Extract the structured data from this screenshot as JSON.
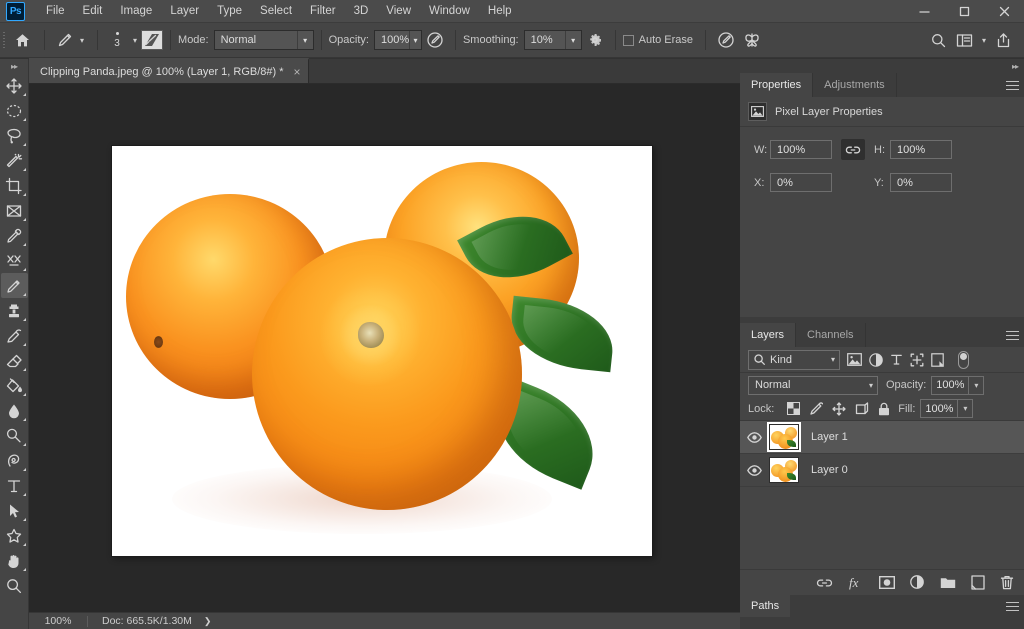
{
  "app": {
    "logo_text": "Ps",
    "menus": [
      "File",
      "Edit",
      "Image",
      "Layer",
      "Type",
      "Select",
      "Filter",
      "3D",
      "View",
      "Window",
      "Help"
    ],
    "window_controls": {
      "minimize": "–",
      "maximize": "☐",
      "close": "✕"
    }
  },
  "options_bar": {
    "home_icon": "home-icon",
    "brush_preset_icon": "pencil-icon",
    "brush_size": "3",
    "brush_panel_icon": "brush-panel-icon",
    "mode_label": "Mode:",
    "mode_value": "Normal",
    "opacity_label": "Opacity:",
    "opacity_value": "100%",
    "pressure_opacity_icon": "pressure-opacity-icon",
    "smoothing_label": "Smoothing:",
    "smoothing_value": "10%",
    "smoothing_options_icon": "gear-icon",
    "auto_erase_label": "Auto Erase",
    "auto_erase_checked": false,
    "pressure_size_icon": "pressure-size-icon",
    "symmetry_icon": "butterfly-symmetry-icon",
    "search_icon": "search-icon",
    "workspace_icon": "workspace-icon",
    "share_icon": "share-icon"
  },
  "toolbar": {
    "collapse_icon": "double-chevron-right-icon",
    "tools": [
      {
        "name": "move-tool",
        "icon": "move-icon",
        "active": false
      },
      {
        "name": "elliptical-marquee-tool",
        "icon": "ellipse-marquee-icon",
        "active": false
      },
      {
        "name": "lasso-tool",
        "icon": "lasso-icon",
        "active": false
      },
      {
        "name": "object-selection-tool",
        "icon": "magic-wand-icon",
        "active": false
      },
      {
        "name": "crop-tool",
        "icon": "crop-icon",
        "active": false
      },
      {
        "name": "frame-tool",
        "icon": "frame-icon",
        "active": false
      },
      {
        "name": "eyedropper-tool",
        "icon": "eyedropper-icon",
        "active": false
      },
      {
        "name": "spot-healing-brush-tool",
        "icon": "healing-brush-icon",
        "active": false
      },
      {
        "name": "pencil-tool",
        "icon": "pencil-icon",
        "active": true
      },
      {
        "name": "clone-stamp-tool",
        "icon": "clone-stamp-icon",
        "active": false
      },
      {
        "name": "history-brush-tool",
        "icon": "history-brush-icon",
        "active": false
      },
      {
        "name": "eraser-tool",
        "icon": "eraser-icon",
        "active": false
      },
      {
        "name": "gradient-tool",
        "icon": "paint-bucket-icon",
        "active": false
      },
      {
        "name": "blur-tool",
        "icon": "water-drop-icon",
        "active": false
      },
      {
        "name": "dodge-tool",
        "icon": "dodge-icon",
        "active": false
      },
      {
        "name": "pen-tool",
        "icon": "pen-icon",
        "active": false
      },
      {
        "name": "type-tool",
        "icon": "type-icon",
        "active": false
      },
      {
        "name": "path-selection-tool",
        "icon": "arrow-pointer-icon",
        "active": false
      },
      {
        "name": "custom-shape-tool",
        "icon": "shape-icon",
        "active": false
      },
      {
        "name": "hand-tool",
        "icon": "hand-icon",
        "active": false
      },
      {
        "name": "zoom-tool",
        "icon": "magnifier-icon",
        "active": false
      }
    ]
  },
  "document": {
    "tab_title": "Clipping Panda.jpeg @ 100% (Layer 1, RGB/8#) *",
    "close_icon": "close-icon"
  },
  "status_bar": {
    "zoom": "100%",
    "doc_info": "Doc: 665.5K/1.30M",
    "expand_icon": "chevron-right-icon"
  },
  "properties_panel": {
    "tabs": [
      {
        "label": "Properties",
        "active": true
      },
      {
        "label": "Adjustments",
        "active": false
      }
    ],
    "menu_icon": "panel-menu-icon",
    "header_icon": "pixel-layer-icon",
    "header_title": "Pixel Layer Properties",
    "fields": {
      "w_label": "W:",
      "w_value": "100%",
      "link_icon": "link-icon",
      "h_label": "H:",
      "h_value": "100%",
      "x_label": "X:",
      "x_value": "0%",
      "y_label": "Y:",
      "y_value": "0%"
    }
  },
  "layers_panel": {
    "tabs": [
      {
        "label": "Layers",
        "active": true
      },
      {
        "label": "Channels",
        "active": false
      }
    ],
    "menu_icon": "panel-menu-icon",
    "filter": {
      "search_icon": "search-icon",
      "kind_value": "Kind",
      "icons": [
        "pixel-filter-icon",
        "adjustment-filter-icon",
        "type-filter-icon",
        "shape-filter-icon",
        "smart-object-filter-icon"
      ],
      "toggle_icon": "filter-toggle-switch"
    },
    "blend": {
      "mode_value": "Normal",
      "opacity_label": "Opacity:",
      "opacity_value": "100%"
    },
    "lock": {
      "label": "Lock:",
      "icons": [
        "lock-transparent-pixels-icon",
        "lock-image-pixels-icon",
        "lock-position-icon",
        "lock-artboard-icon",
        "lock-all-icon"
      ],
      "fill_label": "Fill:",
      "fill_value": "100%"
    },
    "layers": [
      {
        "name": "Layer 1",
        "visible": true,
        "selected": true,
        "eye_icon": "eye-icon"
      },
      {
        "name": "Layer 0",
        "visible": true,
        "selected": false,
        "eye_icon": "eye-icon"
      }
    ],
    "footer_icons": [
      "link-layers-icon",
      "add-layer-style-icon",
      "add-layer-mask-icon",
      "new-fill-adjustment-icon",
      "new-group-icon",
      "new-layer-icon",
      "delete-layer-icon"
    ]
  },
  "paths_panel": {
    "tabs": [
      {
        "label": "Paths",
        "active": true
      }
    ],
    "menu_icon": "panel-menu-icon"
  },
  "canvas": {
    "image_alt": "three-oranges-with-leaves-on-white-background"
  },
  "colors": {
    "accent": "#31a8ff",
    "menubar_bg": "#4b4b4b",
    "panel_bg": "#454545",
    "dock_bg": "#3c3c3c",
    "canvas_bg": "#282828",
    "selected_row": "#565656"
  }
}
